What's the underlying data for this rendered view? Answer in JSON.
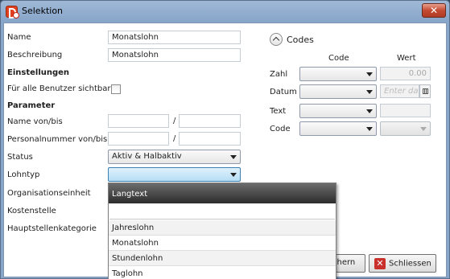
{
  "window": {
    "title": "Selektion",
    "close_glyph": "✕"
  },
  "form": {
    "name_label": "Name",
    "name_value": "Monatslohn",
    "beschreibung_label": "Beschreibung",
    "beschreibung_value": "Monatslohn",
    "einstellungen_heading": "Einstellungen",
    "alle_benutzer_label": "Für alle Benutzer sichtbar",
    "parameter_heading": "Parameter",
    "name_von_bis_label": "Name von/bis",
    "personalnummer_label": "Personalnummer von/bis",
    "range_separator": "/",
    "status_label": "Status",
    "status_value": "Aktiv & Halbaktiv",
    "lohntyp_label": "Lohntyp",
    "lohntyp_value": "",
    "organisationseinheit_label": "Organisationseinheit",
    "kostenstelle_label": "Kostenstelle",
    "hauptstellenkategorie_label": "Hauptstellenkategorie"
  },
  "codes": {
    "heading": "Codes",
    "col_code": "Code",
    "col_wert": "Wert",
    "zahl_label": "Zahl",
    "zahl_value": "0.00",
    "datum_label": "Datum",
    "datum_placeholder": "Enter date",
    "text_label": "Text",
    "code_label": "Code"
  },
  "buttons": {
    "ok_partial": "chern",
    "schliessen": "Schliessen"
  },
  "dropdown": {
    "header": "Langtext",
    "items": [
      "Jahreslohn",
      "Monatslohn",
      "Stundenlohn",
      "Taglohn"
    ]
  },
  "colors": {
    "titlebar": "#9fb8d6",
    "focus": "#b6def6",
    "dropdown_header": "#2c2c2c",
    "close": "#c44a32"
  },
  "icons": [
    "app-icon",
    "close-icon",
    "expand-up-icon",
    "calendar-icon",
    "cancel-icon"
  ]
}
